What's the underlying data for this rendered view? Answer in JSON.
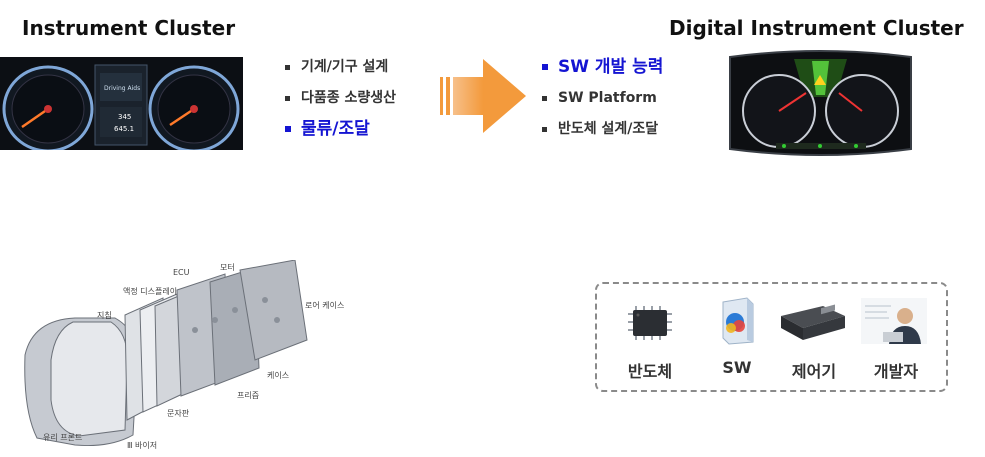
{
  "left": {
    "title": "Instrument Cluster",
    "bullets": [
      "기계/기구 설계",
      "다품종 소량생산",
      "물류/조달"
    ]
  },
  "right": {
    "title": "Digital Instrument  Cluster",
    "bullets": [
      "SW 개발 능력",
      "SW Platform",
      "반도체 설계/조달"
    ]
  },
  "components": {
    "items": [
      "반도체",
      "SW",
      "제어기",
      "개발자"
    ]
  },
  "exploded_view": {
    "labels": [
      "ECU",
      "모터",
      "액정 디스플레이",
      "지침",
      "로어 케이스",
      "케이스",
      "프리즘",
      "문자판",
      "유리 프론트",
      "Ⅲ 바이저"
    ]
  },
  "cluster_left_screen": {
    "readouts": [
      "Driving Aids",
      "345",
      "645.1"
    ]
  },
  "colors": {
    "highlight": "#1414d2",
    "arrow": "#f39a3c",
    "box_border": "#8a8a8a"
  }
}
